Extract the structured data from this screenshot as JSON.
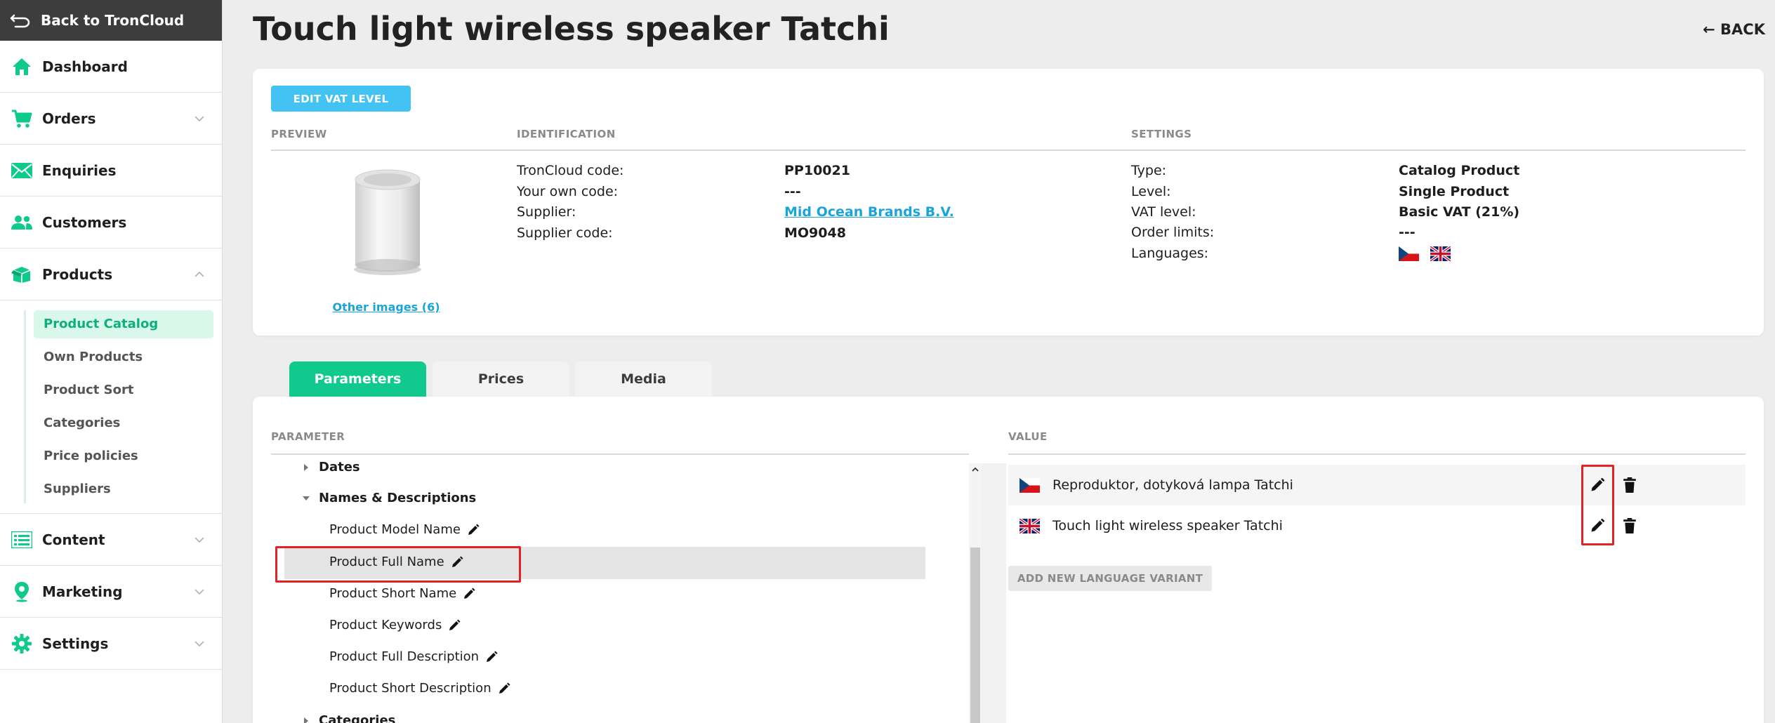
{
  "sidebar": {
    "back_label": "Back to TronCloud",
    "items": [
      {
        "label": "Dashboard",
        "icon": "home-icon"
      },
      {
        "label": "Orders",
        "icon": "cart-icon"
      },
      {
        "label": "Enquiries",
        "icon": "mail-icon"
      },
      {
        "label": "Customers",
        "icon": "users-icon"
      },
      {
        "label": "Products",
        "icon": "box-icon"
      },
      {
        "label": "Content",
        "icon": "list-icon"
      },
      {
        "label": "Marketing",
        "icon": "map-pin-icon"
      },
      {
        "label": "Settings",
        "icon": "gear-icon"
      }
    ],
    "products_sub": [
      "Product Catalog",
      "Own Products",
      "Product Sort",
      "Categories",
      "Price policies",
      "Suppliers"
    ],
    "active_sub": "Product Catalog",
    "accent_color": "#10c98c"
  },
  "page": {
    "title": "Touch light wireless speaker Tatchi",
    "back_label": "BACK"
  },
  "info": {
    "edit_vat_label": "EDIT VAT LEVEL",
    "headers": {
      "preview": "PREVIEW",
      "identification": "IDENTIFICATION",
      "settings": "SETTINGS"
    },
    "other_images": "Other images (6)",
    "identification": [
      {
        "label": "TronCloud code:",
        "value": "PP10021"
      },
      {
        "label": "Your own code:",
        "value": "---"
      },
      {
        "label": "Supplier:",
        "value": "Mid Ocean Brands B.V."
      },
      {
        "label": "Supplier code:",
        "value": "MO9048"
      }
    ],
    "settings": [
      {
        "label": "Type:",
        "value": "Catalog Product"
      },
      {
        "label": "Level:",
        "value": "Single Product"
      },
      {
        "label": "VAT level:",
        "value": "Basic VAT (21%)"
      },
      {
        "label": "Order limits:",
        "value": "---"
      },
      {
        "label": "Languages:",
        "value": ""
      }
    ],
    "languages": [
      "cz-flag-icon",
      "uk-flag-icon"
    ]
  },
  "tabs": [
    "Parameters",
    "Prices",
    "Media"
  ],
  "active_tab": "Parameters",
  "params": {
    "col_parameter": "PARAMETER",
    "col_value": "VALUE",
    "tree": [
      {
        "label": "Dates",
        "type": "group",
        "expanded": false
      },
      {
        "label": "Names & Descriptions",
        "type": "group",
        "expanded": true
      },
      {
        "label": "Product Model Name",
        "type": "leaf"
      },
      {
        "label": "Product Full Name",
        "type": "leaf",
        "selected": true
      },
      {
        "label": "Product Short Name",
        "type": "leaf"
      },
      {
        "label": "Product Keywords",
        "type": "leaf"
      },
      {
        "label": "Product Full Description",
        "type": "leaf"
      },
      {
        "label": "Product Short Description",
        "type": "leaf"
      },
      {
        "label": "Categories",
        "type": "group",
        "expanded": false
      }
    ],
    "values": [
      {
        "flag": "cz-flag-icon",
        "text": "Reproduktor, dotyková lampa Tatchi"
      },
      {
        "flag": "uk-flag-icon",
        "text": "Touch light wireless speaker Tatchi"
      }
    ],
    "add_variant_label": "ADD NEW LANGUAGE VARIANT"
  }
}
